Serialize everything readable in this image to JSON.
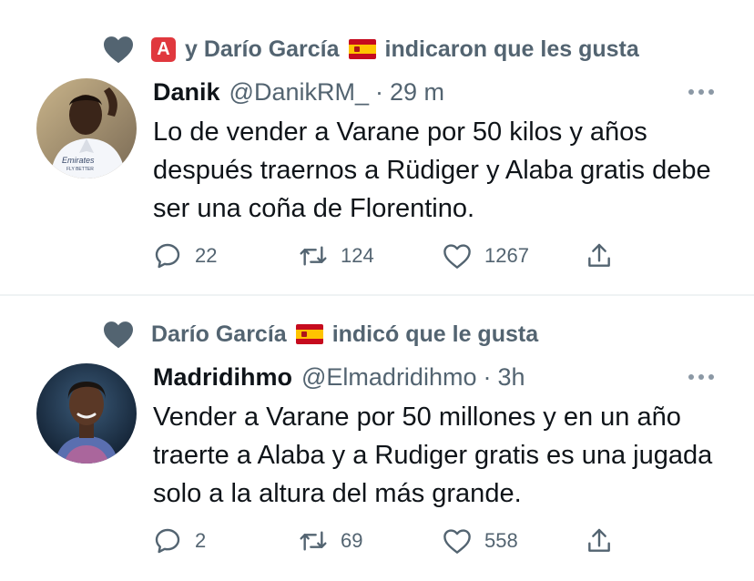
{
  "tweets": [
    {
      "social_prefix_badge": "A",
      "social_text_1": "y Darío García",
      "social_text_2": "indicaron que les gusta",
      "author_name": "Danik",
      "handle": "@DanikRM_",
      "separator": "·",
      "time": "29 m",
      "text": "Lo de vender a Varane por 50 kilos y años después traernos a Rüdiger y Alaba gratis debe ser una coña de Florentino.",
      "avatar_text_1": "Emirates",
      "avatar_text_2": "FLY BETTER",
      "replies": "22",
      "retweets": "124",
      "likes": "1267"
    },
    {
      "social_text_1": "Darío García",
      "social_text_2": "indicó que le gusta",
      "author_name": "Madridihmo",
      "handle": "@Elmadridihmo",
      "separator": "·",
      "time": "3h",
      "text": "Vender a Varane por 50 millones y en un año traerte a Alaba y a Rudiger gratis es una jugada solo a la altura del más grande.",
      "replies": "2",
      "retweets": "69",
      "likes": "558"
    }
  ],
  "colors": {
    "text_primary": "#0f1419",
    "text_secondary": "#536471",
    "divider": "#eff3f4",
    "badge_red": "#e0383e"
  },
  "icons": [
    "heart-filled-icon",
    "more-dots-icon",
    "reply-icon",
    "retweet-icon",
    "like-icon",
    "share-icon",
    "spain-flag-icon"
  ]
}
